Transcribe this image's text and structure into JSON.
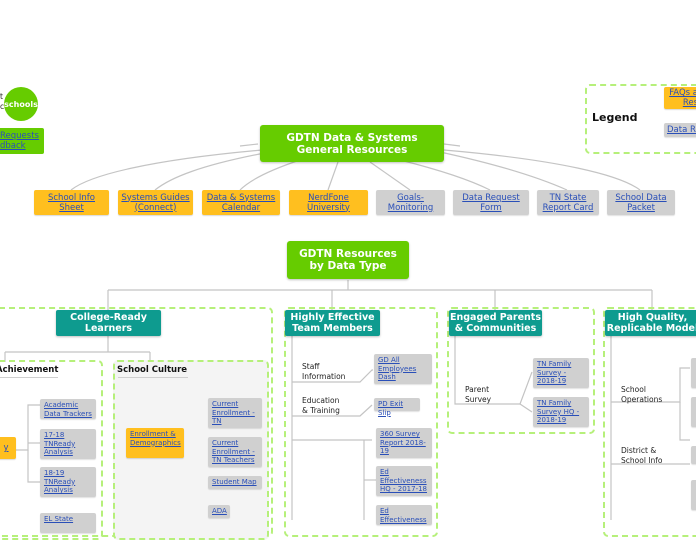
{
  "top_left": {
    "partial_text_line1": "t",
    "partial_text_line2": "c",
    "logo_text": "schools",
    "requests_button": {
      "line1": "Requests",
      "line2": "dback"
    }
  },
  "legend": {
    "title": "Legend",
    "items": [
      {
        "label_line1": "FAQs a",
        "label_line2": "Res",
        "color": "#ffbf1f"
      },
      {
        "label": "Data Re",
        "color": "#d0d0d0"
      }
    ]
  },
  "general": {
    "root": {
      "line1": "GDTN Data & Systems",
      "line2": "General Resources"
    },
    "children": [
      {
        "line1": "School Info",
        "line2": "Sheet",
        "type": "faq"
      },
      {
        "line1": "Systems Guides",
        "line2": "(Connect)",
        "type": "faq"
      },
      {
        "line1": "Data & Systems",
        "line2": "Calendar",
        "type": "faq"
      },
      {
        "line1": "NerdFone",
        "line2": "University",
        "type": "faq"
      },
      {
        "line1": "Goals-",
        "line2": "Monitoring",
        "type": "data"
      },
      {
        "line1": "Data Request",
        "line2": "Form",
        "type": "data"
      },
      {
        "line1": "TN State",
        "line2": "Report Card",
        "type": "data"
      },
      {
        "line1": "School Data",
        "line2": "Packet",
        "type": "data"
      }
    ]
  },
  "by_type": {
    "root": {
      "line1": "GDTN Resources",
      "line2": "by Data Type"
    },
    "categories": [
      {
        "title_line1": "College-Ready",
        "title_line2": "Learners",
        "groups": [
          {
            "title": "Achievement",
            "items": [
              {
                "label": "y",
                "type": "faq"
              },
              {
                "label": "Academic Data Trackers",
                "type": "data"
              },
              {
                "label": "17-18 TNReady Analysis",
                "type": "data"
              },
              {
                "label": "18-19 TNReady Analysis",
                "type": "data"
              },
              {
                "label": "EL State",
                "type": "data"
              }
            ]
          },
          {
            "title": "School Culture",
            "items": [
              {
                "label": "Enrollment & Demographics",
                "type": "faq"
              },
              {
                "label": "Current Enrollment - TN",
                "type": "data"
              },
              {
                "label": "Current Enrollment - TN Teachers",
                "type": "data"
              },
              {
                "label": "Student Map",
                "type": "data"
              },
              {
                "label": "ADA",
                "type": "data"
              }
            ]
          }
        ]
      },
      {
        "title_line1": "Highly Effective",
        "title_line2": "Team Members",
        "topics": [
          {
            "label_line1": "Staff",
            "label_line2": "Information",
            "items": [
              "GD All Employees Dash"
            ]
          },
          {
            "label_line1": "Education",
            "label_line2": "& Training",
            "items": [
              "PD Exit Slip"
            ]
          },
          {
            "label_line1": "",
            "label_line2": "",
            "items": [
              "360 Survey Report 2018-19",
              "Ed Effectiveness HQ - 2017-18",
              "Ed Effectiveness"
            ]
          }
        ]
      },
      {
        "title_line1": "Engaged Parents",
        "title_line2": "& Communities",
        "topics": [
          {
            "label_line1": "Parent",
            "label_line2": "Survey",
            "items": [
              "TN Family Survey - 2018-19",
              "TN Family Survey HQ - 2018-19"
            ]
          }
        ]
      },
      {
        "title_line1": "High Quality,",
        "title_line2": "Replicable Model",
        "topics": [
          {
            "label_line1": "School",
            "label_line2": "Operations"
          },
          {
            "label_line1": "District &",
            "label_line2": "School Info"
          }
        ]
      }
    ]
  },
  "colors": {
    "root_green": "#66cc00",
    "category_teal": "#0e9b8f",
    "faq_yellow": "#ffbf1f",
    "data_gray": "#d0d0d0",
    "frame_dash": "#b6f07a",
    "link_blue": "#2a4fb8"
  }
}
